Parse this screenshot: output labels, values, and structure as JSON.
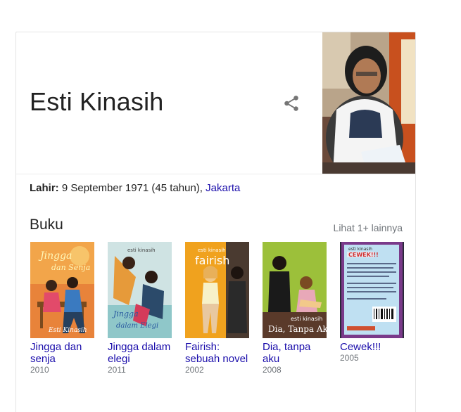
{
  "entity": {
    "name": "Esti Kinasih",
    "born_label": "Lahir:",
    "born_value": " 9 September 1971 (45 tahun), ",
    "born_place": "Jakarta"
  },
  "books_section": {
    "title": "Buku",
    "more_link": "Lihat 1+ lainnya",
    "items": [
      {
        "title": "Jingga dan senja",
        "year": "2010",
        "cover_text": "Jingga dan Senja",
        "cover_author": "Esti Kinasih"
      },
      {
        "title": "Jingga dalam elegi",
        "year": "2011",
        "cover_text": "Jingga dalam Elegi",
        "cover_author": "esti kinasih"
      },
      {
        "title": "Fairish: sebuah novel",
        "year": "2002",
        "cover_text": "fairish",
        "cover_author": "esti kinasih"
      },
      {
        "title": "Dia, tanpa aku",
        "year": "2008",
        "cover_text": "Dia, Tanpa Aku",
        "cover_author": "esti kinasih"
      },
      {
        "title": "Cewek!!!",
        "year": "2005",
        "cover_text": "CEWEK!!!",
        "cover_author": "esti kinasih"
      }
    ]
  },
  "colors": {
    "link": "#1a0dab",
    "muted": "#70757a",
    "text": "#222222"
  },
  "icons": {
    "share": "share-icon"
  }
}
